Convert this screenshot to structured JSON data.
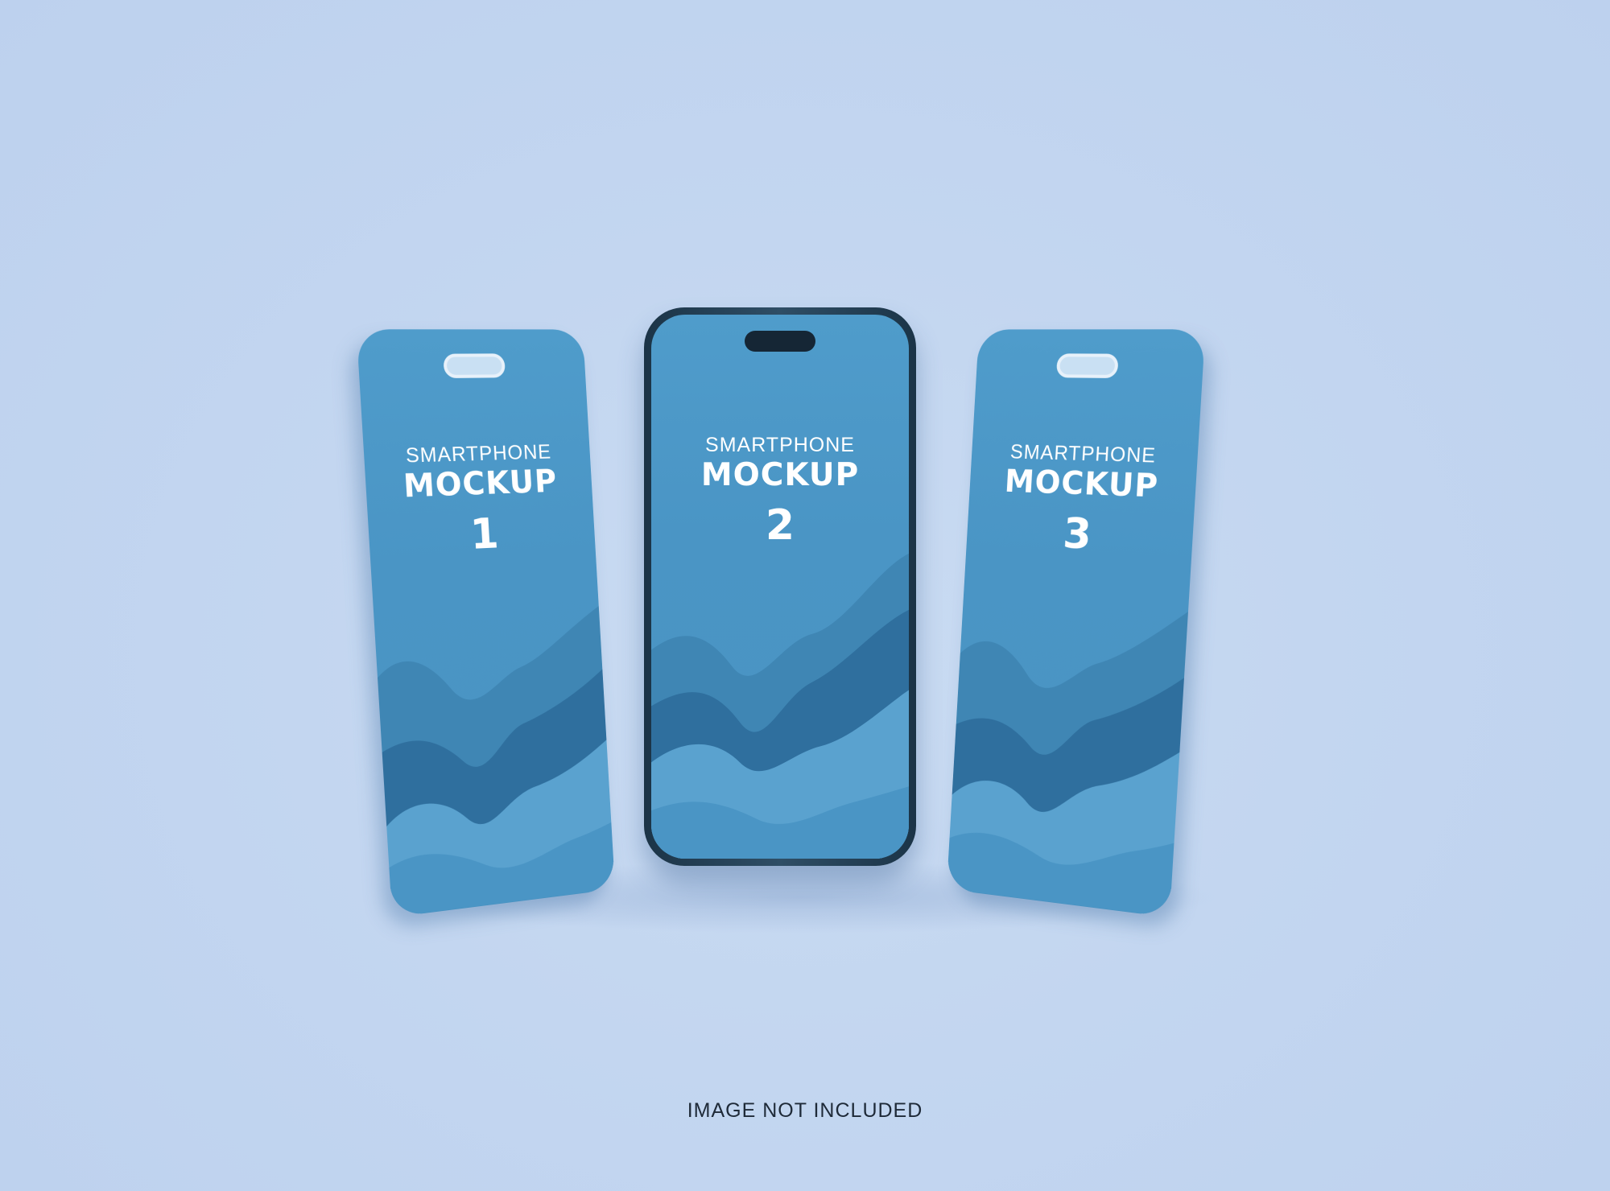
{
  "background_color": "#c3d6f0",
  "screen_color": "#4b97c6",
  "frame_color": "#1f3a50",
  "phones": [
    {
      "line1": "SMARTPHONE",
      "line2": "MOCKUP",
      "number": "1"
    },
    {
      "line1": "SMARTPHONE",
      "line2": "MOCKUP",
      "number": "2"
    },
    {
      "line1": "SMARTPHONE",
      "line2": "MOCKUP",
      "number": "3"
    }
  ],
  "caption": "IMAGE NOT INCLUDED"
}
